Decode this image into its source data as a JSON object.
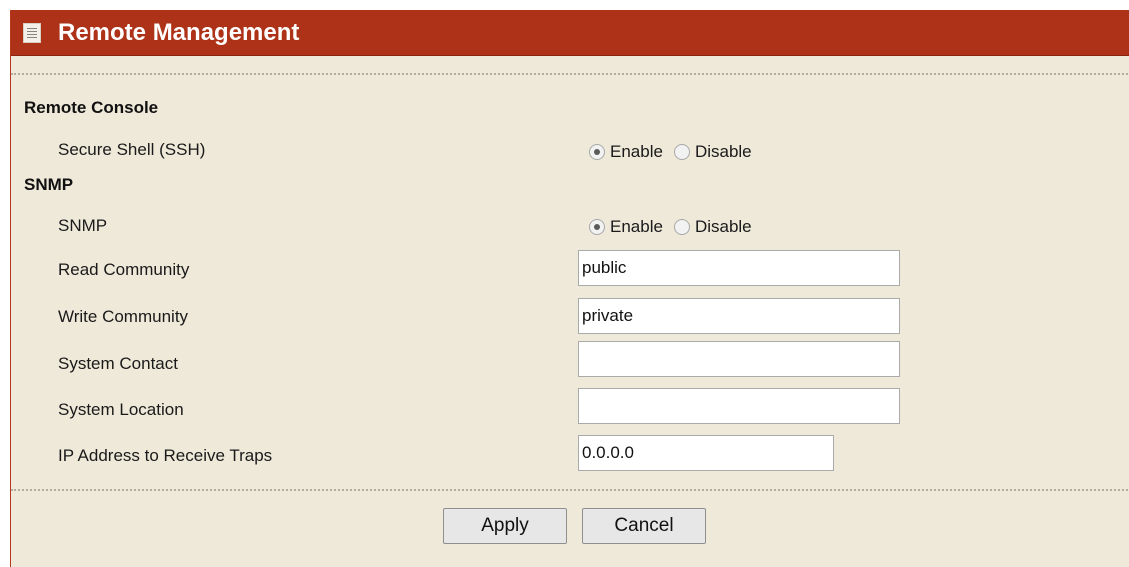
{
  "header": {
    "title": "Remote Management",
    "icon": "document-icon"
  },
  "remote_console": {
    "section_title": "Remote Console",
    "ssh": {
      "label": "Secure Shell (SSH)",
      "enable_label": "Enable",
      "disable_label": "Disable",
      "selected": "Enable"
    }
  },
  "snmp": {
    "section_title": "SNMP",
    "snmp_toggle": {
      "label": "SNMP",
      "enable_label": "Enable",
      "disable_label": "Disable",
      "selected": "Enable"
    },
    "read_community": {
      "label": "Read Community",
      "value": "public"
    },
    "write_community": {
      "label": "Write Community",
      "value": "private"
    },
    "system_contact": {
      "label": "System Contact",
      "value": ""
    },
    "system_location": {
      "label": "System Location",
      "value": ""
    },
    "trap_ip": {
      "label": "IP Address to Receive Traps",
      "value": "0.0.0.0"
    }
  },
  "buttons": {
    "apply": "Apply",
    "cancel": "Cancel"
  },
  "colors": {
    "title_bar": "#ad3218",
    "panel_background": "#efe9d9",
    "title_text": "#ffffff"
  }
}
